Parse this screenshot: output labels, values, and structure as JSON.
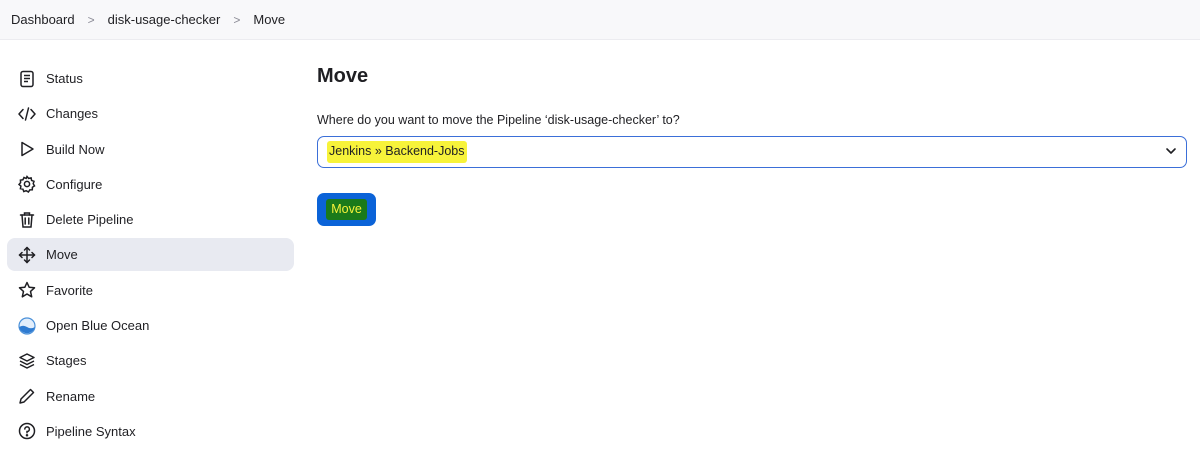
{
  "breadcrumb": {
    "items": [
      "Dashboard",
      "disk-usage-checker",
      "Move"
    ],
    "separator": ">"
  },
  "sidebar": {
    "items": [
      {
        "label": "Status",
        "icon": "status-icon"
      },
      {
        "label": "Changes",
        "icon": "code-icon"
      },
      {
        "label": "Build Now",
        "icon": "play-icon"
      },
      {
        "label": "Configure",
        "icon": "gear-icon"
      },
      {
        "label": "Delete Pipeline",
        "icon": "trash-icon"
      },
      {
        "label": "Move",
        "icon": "move-icon",
        "active": true
      },
      {
        "label": "Favorite",
        "icon": "star-icon"
      },
      {
        "label": "Open Blue Ocean",
        "icon": "blue-ocean-icon"
      },
      {
        "label": "Stages",
        "icon": "stages-icon"
      },
      {
        "label": "Rename",
        "icon": "pencil-icon"
      },
      {
        "label": "Pipeline Syntax",
        "icon": "help-icon"
      }
    ]
  },
  "main": {
    "title": "Move",
    "question": "Where do you want to move the Pipeline ‘disk-usage-checker’ to?",
    "destination_selected": "Jenkins » Backend-Jobs",
    "move_button": "Move"
  },
  "colors": {
    "accent": "#0b63d8",
    "highlight": "#f7f33a",
    "active_bg": "#e8eaf1"
  }
}
